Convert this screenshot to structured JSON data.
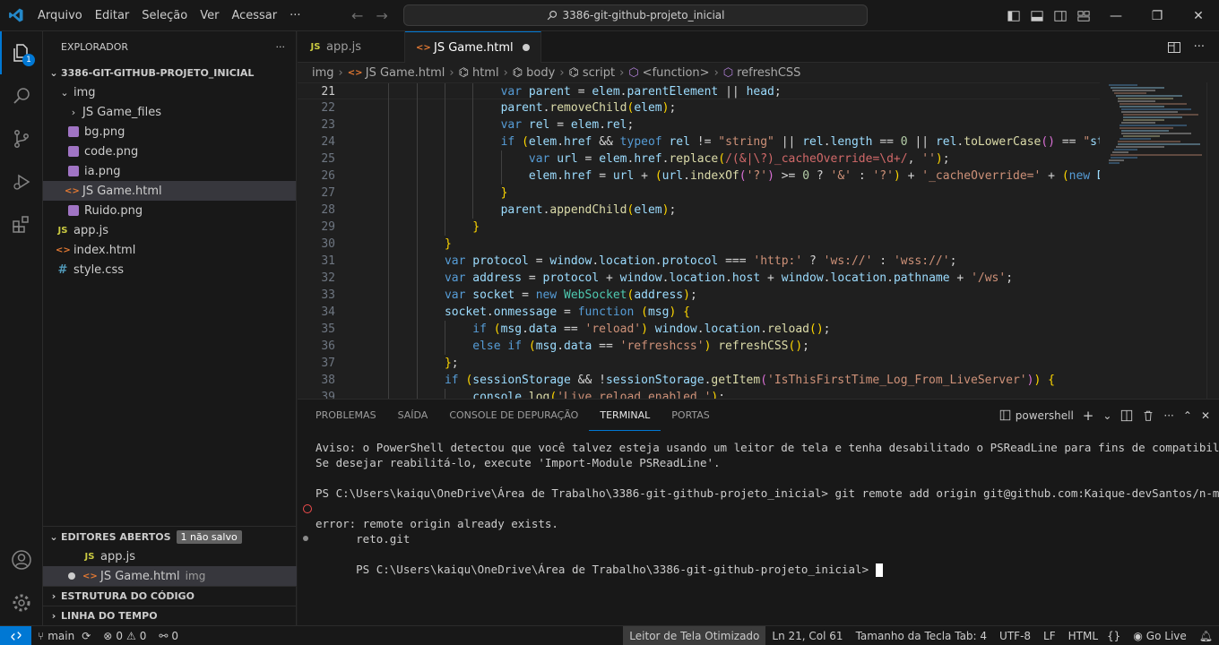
{
  "titlebar": {
    "menu": [
      "Arquivo",
      "Editar",
      "Seleção",
      "Ver",
      "Acessar",
      "···"
    ],
    "search": "3386-git-github-projeto_inicial"
  },
  "activity": {
    "badge": "1"
  },
  "sidebar": {
    "title": "EXPLORADOR",
    "project": "3386-GIT-GITHUB-PROJETO_INICIAL",
    "tree": [
      {
        "label": "img",
        "kind": "folder-open"
      },
      {
        "label": "JS Game_files",
        "kind": "folder"
      },
      {
        "label": "bg.png",
        "kind": "img"
      },
      {
        "label": "code.png",
        "kind": "img"
      },
      {
        "label": "ia.png",
        "kind": "img"
      },
      {
        "label": "JS Game.html",
        "kind": "html"
      },
      {
        "label": "Ruido.png",
        "kind": "img"
      },
      {
        "label": "app.js",
        "kind": "js"
      },
      {
        "label": "index.html",
        "kind": "html"
      },
      {
        "label": "style.css",
        "kind": "css"
      }
    ],
    "open_editors": {
      "title": "EDITORES ABERTOS",
      "badge": "1 não salvo",
      "items": [
        {
          "label": "app.js",
          "desc": ""
        },
        {
          "label": "JS Game.html",
          "desc": "img"
        }
      ]
    },
    "outline": "ESTRUTURA DO CÓDIGO",
    "timeline": "LINHA DO TEMPO"
  },
  "tabs": [
    {
      "icon": "JS",
      "label": "app.js"
    },
    {
      "icon": "<>",
      "label": "JS Game.html"
    }
  ],
  "breadcrumb": [
    "img",
    "JS Game.html",
    "html",
    "body",
    "script",
    "<function>",
    "refreshCSS"
  ],
  "editor": {
    "lines": [
      {
        "n": "21",
        "text": "var parent = elem.parentElement || head;"
      },
      {
        "n": "22",
        "text": "parent.removeChild(elem);"
      },
      {
        "n": "23",
        "text": "var rel = elem.rel;"
      },
      {
        "n": "24",
        "text": "if (elem.href && typeof rel != \"string\" || rel.length == 0 || rel.toLowerCase() == \"styl"
      },
      {
        "n": "25",
        "text": "var url = elem.href.replace(/(&|\\?)_cacheOverride=\\d+/, '');"
      },
      {
        "n": "26",
        "text": "elem.href = url + (url.indexOf('?') >= 0 ? '&' : '?') + '_cacheOverride=' + (new Dat"
      },
      {
        "n": "27",
        "text": "}"
      },
      {
        "n": "28",
        "text": "parent.appendChild(elem);"
      },
      {
        "n": "29",
        "text": "}"
      },
      {
        "n": "30",
        "text": "}"
      },
      {
        "n": "31",
        "text": "var protocol = window.location.protocol === 'http:' ? 'ws://' : 'wss://';"
      },
      {
        "n": "32",
        "text": "var address = protocol + window.location.host + window.location.pathname + '/ws';"
      },
      {
        "n": "33",
        "text": "var socket = new WebSocket(address);"
      },
      {
        "n": "34",
        "text": "socket.onmessage = function (msg) {"
      },
      {
        "n": "35",
        "text": "if (msg.data == 'reload') window.location.reload();"
      },
      {
        "n": "36",
        "text": "else if (msg.data == 'refreshcss') refreshCSS();"
      },
      {
        "n": "37",
        "text": "};"
      },
      {
        "n": "38",
        "text": "if (sessionStorage && !sessionStorage.getItem('IsThisFirstTime_Log_From_LiveServer')) {"
      },
      {
        "n": "39",
        "text": "console.log('Live reload enabled.');"
      }
    ]
  },
  "panel": {
    "tabs": [
      "PROBLEMAS",
      "SAÍDA",
      "CONSOLE DE DEPURAÇÃO",
      "TERMINAL",
      "PORTAS"
    ],
    "shell": "powershell",
    "terminal": [
      "Aviso: o PowerShell detectou que você talvez esteja usando um leitor de tela e tenha desabilitado o PSReadLine para fins de compatibilidade.",
      "Se desejar reabilitá-lo, execute 'Import-Module PSReadLine'.",
      "",
      "PS C:\\Users\\kaiqu\\OneDrive\\Área de Trabalho\\3386-git-github-projeto_inicial> git remote add origin git@github.com:Kaique-devSantos/n-mero-sec",
      "reto.git",
      "error: remote origin already exists.",
      "PS C:\\Users\\kaiqu\\OneDrive\\Área de Trabalho\\3386-git-github-projeto_inicial> "
    ]
  },
  "status": {
    "branch": "main",
    "errors": "0",
    "warnings": "0",
    "ports": "0",
    "screen_reader": "Leitor de Tela Otimizado",
    "position": "Ln 21, Col 61",
    "tab_size": "Tamanho da Tecla Tab: 4",
    "encoding": "UTF-8",
    "eol": "LF",
    "language": "HTML",
    "live": "Go Live"
  },
  "colors": {
    "accent": "#0078d4",
    "error": "#f14c4c"
  }
}
